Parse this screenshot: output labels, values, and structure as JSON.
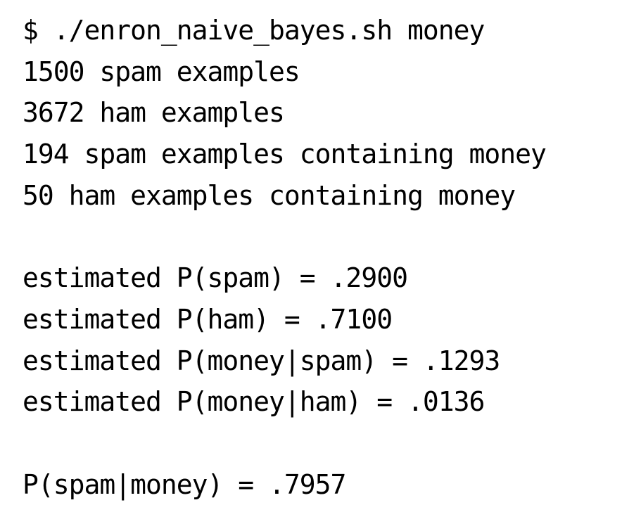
{
  "terminal": {
    "command_line": "$ ./enron_naive_bayes.sh money",
    "counts": [
      "1500 spam examples",
      "3672 ham examples",
      "194 spam examples containing money",
      "50 ham examples containing money"
    ],
    "estimates": [
      "estimated P(spam) = .2900",
      "estimated P(ham) = .7100",
      "estimated P(money|spam) = .1293",
      "estimated P(money|ham) = .0136"
    ],
    "result": "P(spam|money) = .7957"
  }
}
